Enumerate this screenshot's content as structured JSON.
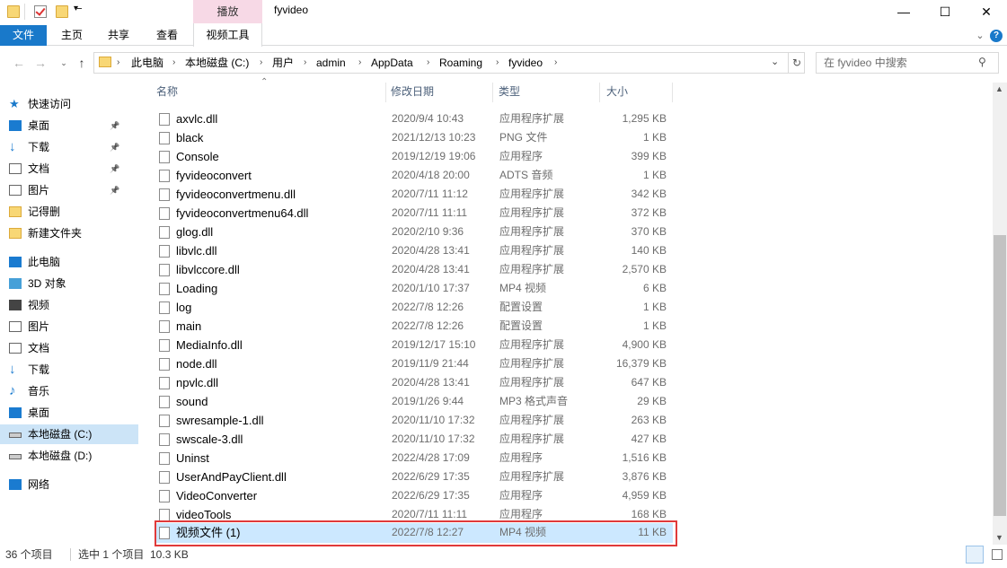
{
  "window": {
    "title": "fyvideo",
    "context_tab": "播放",
    "minimize": "—",
    "maximize": "☐",
    "close": "✕"
  },
  "ribbon": {
    "file": "文件",
    "home": "主页",
    "share": "共享",
    "view": "查看",
    "video_tools": "视频工具",
    "help": "?"
  },
  "address": {
    "path": [
      "此电脑",
      "本地磁盘 (C:)",
      "用户",
      "admin",
      "AppData",
      "Roaming",
      "fyvideo"
    ],
    "search_placeholder": "在 fyvideo 中搜索"
  },
  "sidebar": {
    "quick_access": "快速访问",
    "quick_items": [
      {
        "label": "桌面",
        "pinned": true
      },
      {
        "label": "下载",
        "pinned": true
      },
      {
        "label": "文档",
        "pinned": true
      },
      {
        "label": "图片",
        "pinned": true
      },
      {
        "label": "记得删",
        "pinned": false
      },
      {
        "label": "新建文件夹",
        "pinned": false
      }
    ],
    "this_pc": "此电脑",
    "pc_items": [
      {
        "label": "3D 对象"
      },
      {
        "label": "视频"
      },
      {
        "label": "图片"
      },
      {
        "label": "文档"
      },
      {
        "label": "下载"
      },
      {
        "label": "音乐"
      },
      {
        "label": "桌面"
      },
      {
        "label": "本地磁盘 (C:)"
      },
      {
        "label": "本地磁盘 (D:)"
      }
    ],
    "network": "网络"
  },
  "columns": {
    "name": "名称",
    "date": "修改日期",
    "type": "类型",
    "size": "大小"
  },
  "files": [
    {
      "name": "axvlc.dll",
      "date": "2020/9/4 10:43",
      "type": "应用程序扩展",
      "size": "1,295 KB"
    },
    {
      "name": "black",
      "date": "2021/12/13 10:23",
      "type": "PNG 文件",
      "size": "1 KB"
    },
    {
      "name": "Console",
      "date": "2019/12/19 19:06",
      "type": "应用程序",
      "size": "399 KB"
    },
    {
      "name": "fyvideoconvert",
      "date": "2020/4/18 20:00",
      "type": "ADTS 音频",
      "size": "1 KB"
    },
    {
      "name": "fyvideoconvertmenu.dll",
      "date": "2020/7/11 11:12",
      "type": "应用程序扩展",
      "size": "342 KB"
    },
    {
      "name": "fyvideoconvertmenu64.dll",
      "date": "2020/7/11 11:11",
      "type": "应用程序扩展",
      "size": "372 KB"
    },
    {
      "name": "glog.dll",
      "date": "2020/2/10 9:36",
      "type": "应用程序扩展",
      "size": "370 KB"
    },
    {
      "name": "libvlc.dll",
      "date": "2020/4/28 13:41",
      "type": "应用程序扩展",
      "size": "140 KB"
    },
    {
      "name": "libvlccore.dll",
      "date": "2020/4/28 13:41",
      "type": "应用程序扩展",
      "size": "2,570 KB"
    },
    {
      "name": "Loading",
      "date": "2020/1/10 17:37",
      "type": "MP4 视频",
      "size": "6 KB"
    },
    {
      "name": "log",
      "date": "2022/7/8 12:26",
      "type": "配置设置",
      "size": "1 KB"
    },
    {
      "name": "main",
      "date": "2022/7/8 12:26",
      "type": "配置设置",
      "size": "1 KB"
    },
    {
      "name": "MediaInfo.dll",
      "date": "2019/12/17 15:10",
      "type": "应用程序扩展",
      "size": "4,900 KB"
    },
    {
      "name": "node.dll",
      "date": "2019/11/9 21:44",
      "type": "应用程序扩展",
      "size": "16,379 KB"
    },
    {
      "name": "npvlc.dll",
      "date": "2020/4/28 13:41",
      "type": "应用程序扩展",
      "size": "647 KB"
    },
    {
      "name": "sound",
      "date": "2019/1/26 9:44",
      "type": "MP3 格式声音",
      "size": "29 KB"
    },
    {
      "name": "swresample-1.dll",
      "date": "2020/11/10 17:32",
      "type": "应用程序扩展",
      "size": "263 KB"
    },
    {
      "name": "swscale-3.dll",
      "date": "2020/11/10 17:32",
      "type": "应用程序扩展",
      "size": "427 KB"
    },
    {
      "name": "Uninst",
      "date": "2022/4/28 17:09",
      "type": "应用程序",
      "size": "1,516 KB"
    },
    {
      "name": "UserAndPayClient.dll",
      "date": "2022/6/29 17:35",
      "type": "应用程序扩展",
      "size": "3,876 KB"
    },
    {
      "name": "VideoConverter",
      "date": "2022/6/29 17:35",
      "type": "应用程序",
      "size": "4,959 KB"
    },
    {
      "name": "videoTools",
      "date": "2020/7/11 11:11",
      "type": "应用程序",
      "size": "168 KB"
    },
    {
      "name": "视频文件 (1)",
      "date": "2022/7/8 12:27",
      "type": "MP4 视频",
      "size": "11 KB",
      "selected": true
    }
  ],
  "status": {
    "count": "36 个项目",
    "selected": "选中 1 个项目  10.3 KB"
  }
}
